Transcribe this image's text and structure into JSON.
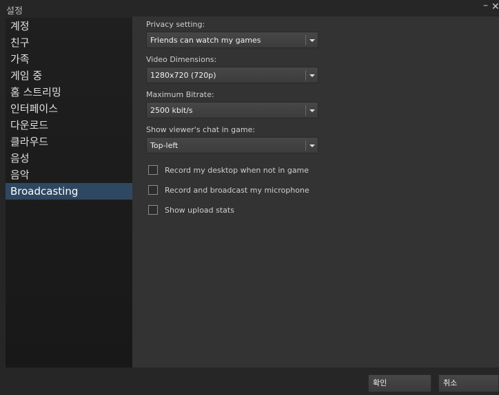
{
  "window": {
    "title": "설정",
    "minimize_glyph": "–",
    "close_glyph": "✕"
  },
  "sidebar": {
    "items": [
      {
        "label": "계정"
      },
      {
        "label": "친구"
      },
      {
        "label": "가족"
      },
      {
        "label": "게임 중"
      },
      {
        "label": "홈 스트리밍"
      },
      {
        "label": "인터페이스"
      },
      {
        "label": "다운로드"
      },
      {
        "label": "클라우드"
      },
      {
        "label": "음성"
      },
      {
        "label": "음악"
      },
      {
        "label": "Broadcasting"
      }
    ],
    "active_index": 10
  },
  "broadcasting": {
    "privacy": {
      "label": "Privacy setting:",
      "value": "Friends can watch my games"
    },
    "dimensions": {
      "label": "Video Dimensions:",
      "value": "1280x720 (720p)"
    },
    "bitrate": {
      "label": "Maximum Bitrate:",
      "value": "2500 kbit/s"
    },
    "chat": {
      "label": "Show viewer's chat in game:",
      "value": "Top-left"
    },
    "checkboxes": [
      {
        "label": "Record my desktop when not in game",
        "checked": false
      },
      {
        "label": "Record and broadcast my microphone",
        "checked": false
      },
      {
        "label": "Show upload stats",
        "checked": false
      }
    ]
  },
  "footer": {
    "ok_label": "확인",
    "cancel_label": "취소"
  },
  "colors": {
    "background": "#262626",
    "panel": "#333333",
    "sidebar": "#1c1c1c",
    "active_item": "#2f4862"
  }
}
